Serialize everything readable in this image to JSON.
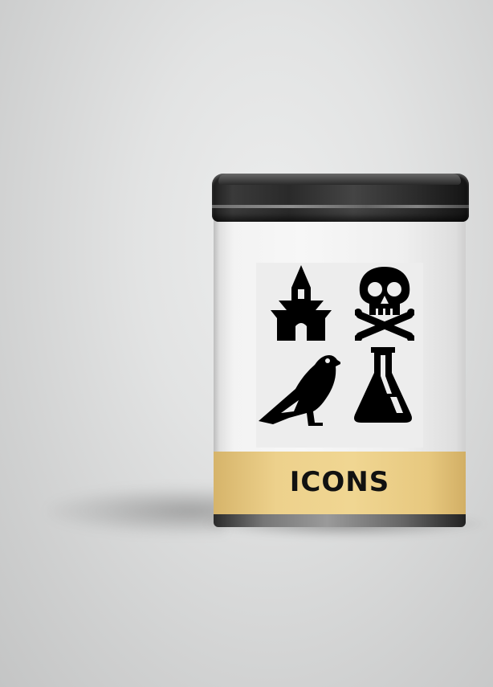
{
  "product": {
    "label": "ICONS"
  },
  "icons": [
    {
      "name": "haunted-house-icon"
    },
    {
      "name": "skull-crossbones-icon"
    },
    {
      "name": "raven-icon"
    },
    {
      "name": "potion-flask-icon"
    }
  ],
  "colors": {
    "label_band": "#edd18c",
    "lid": "#2a2a2a",
    "tin_body": "#f3f3f3",
    "icon_fill": "#000000",
    "background": "#dcdddd"
  }
}
